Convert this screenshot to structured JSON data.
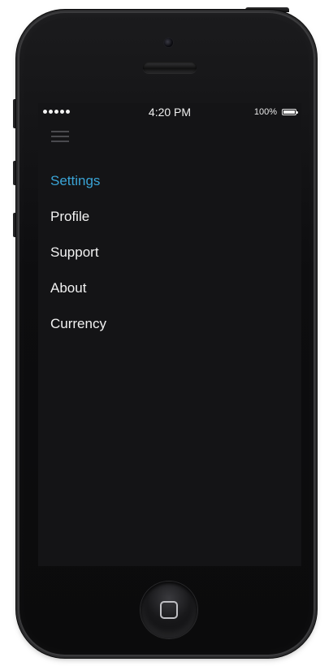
{
  "status_bar": {
    "signal_dots": 5,
    "time": "4:20 PM",
    "battery_percent": "100%",
    "battery_level": 1.0
  },
  "menu": {
    "icon": "hamburger-menu-icon",
    "items": [
      {
        "label": "Settings",
        "active": true
      },
      {
        "label": "Profile",
        "active": false
      },
      {
        "label": "Support",
        "active": false
      },
      {
        "label": "About",
        "active": false
      },
      {
        "label": "Currency",
        "active": false
      }
    ]
  },
  "colors": {
    "active_item": "#3aa4d6",
    "item_text": "#f2f2f2",
    "screen_background": "#141416"
  }
}
